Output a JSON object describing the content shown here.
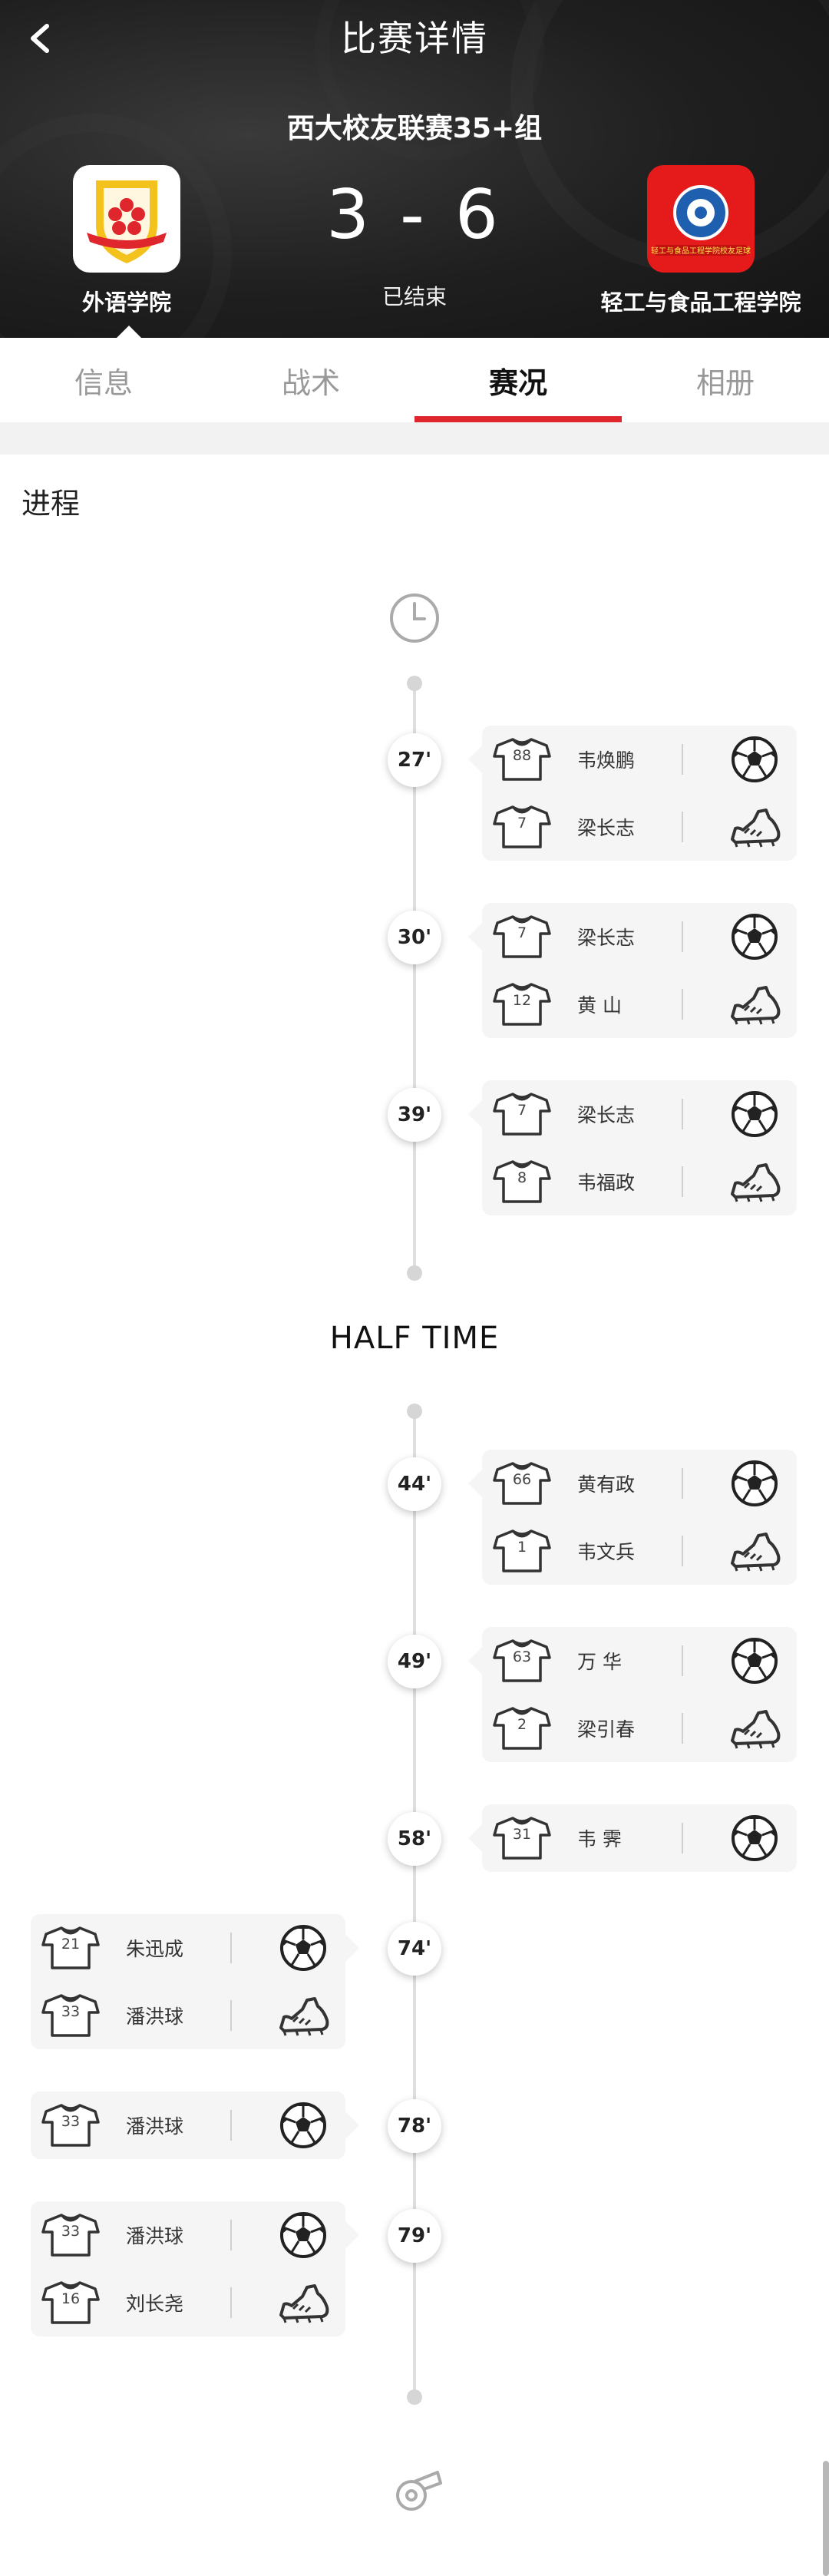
{
  "header": {
    "title": "比赛详情",
    "league": "西大校友联赛35+组",
    "home_team": "外语学院",
    "away_team": "轻工与食品工程学院",
    "away_logo_text": "轻工与食品工程学院校友足球",
    "score": "3 - 6",
    "status": "已结束"
  },
  "tabs": [
    "信息",
    "战术",
    "赛况",
    "相册"
  ],
  "active_tab": 2,
  "section": {
    "title": "进程"
  },
  "half_time_label": "HALF TIME",
  "events": [
    {
      "minute": "27'",
      "side": "right",
      "scorer": {
        "number": "88",
        "name": "韦焕鹏"
      },
      "assist": {
        "number": "7",
        "name": "梁长志"
      }
    },
    {
      "minute": "30'",
      "side": "right",
      "scorer": {
        "number": "7",
        "name": "梁长志"
      },
      "assist": {
        "number": "12",
        "name": "黄  山"
      }
    },
    {
      "minute": "39'",
      "side": "right",
      "scorer": {
        "number": "7",
        "name": "梁长志"
      },
      "assist": {
        "number": "8",
        "name": "韦福政"
      }
    },
    {
      "minute": "44'",
      "side": "right",
      "scorer": {
        "number": "66",
        "name": "黄有政"
      },
      "assist": {
        "number": "1",
        "name": "韦文兵"
      }
    },
    {
      "minute": "49'",
      "side": "right",
      "scorer": {
        "number": "63",
        "name": "万  华"
      },
      "assist": {
        "number": "2",
        "name": "梁引春"
      }
    },
    {
      "minute": "58'",
      "side": "right",
      "scorer": {
        "number": "31",
        "name": "韦  霁"
      }
    },
    {
      "minute": "74'",
      "side": "left",
      "scorer": {
        "number": "21",
        "name": "朱迅成"
      },
      "assist": {
        "number": "33",
        "name": "潘洪球"
      }
    },
    {
      "minute": "78'",
      "side": "left",
      "scorer": {
        "number": "33",
        "name": "潘洪球"
      }
    },
    {
      "minute": "79'",
      "side": "left",
      "scorer": {
        "number": "33",
        "name": "潘洪球"
      },
      "assist": {
        "number": "16",
        "name": "刘长尧"
      }
    }
  ],
  "icons": {
    "back": "chevron-left-icon",
    "goal": "soccer-ball-icon",
    "assist": "boot-icon",
    "player": "jersey-icon",
    "start": "clock-icon",
    "end": "whistle-icon"
  },
  "colors": {
    "accent": "#e0262d",
    "home_logo_bg": "#ffffff",
    "away_logo_bg": "#e51a1a"
  }
}
